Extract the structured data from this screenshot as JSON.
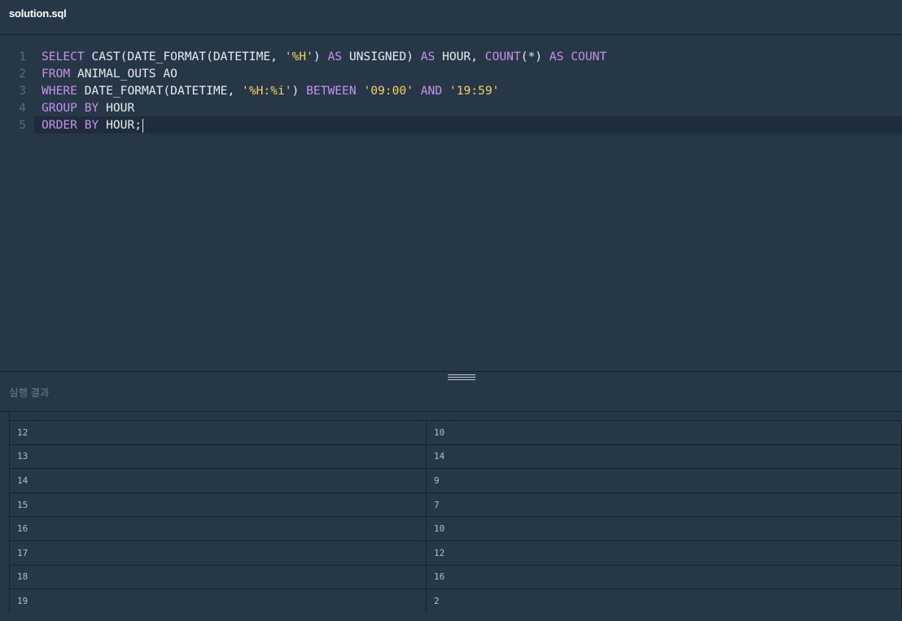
{
  "tab": {
    "title": "solution.sql"
  },
  "editor": {
    "line_numbers": [
      "1",
      "2",
      "3",
      "4",
      "5"
    ],
    "lines": [
      [
        {
          "t": "kw",
          "v": "SELECT"
        },
        {
          "t": "p",
          "v": " CAST(DATE_FORMAT(DATETIME, "
        },
        {
          "t": "str",
          "v": "'%H'"
        },
        {
          "t": "p",
          "v": ") "
        },
        {
          "t": "kw",
          "v": "AS"
        },
        {
          "t": "p",
          "v": " UNSIGNED) "
        },
        {
          "t": "kw",
          "v": "AS"
        },
        {
          "t": "p",
          "v": " HOUR, "
        },
        {
          "t": "kw",
          "v": "COUNT"
        },
        {
          "t": "p",
          "v": "(*) "
        },
        {
          "t": "kw",
          "v": "AS"
        },
        {
          "t": "p",
          "v": " "
        },
        {
          "t": "kw",
          "v": "COUNT"
        }
      ],
      [
        {
          "t": "kw",
          "v": "FROM"
        },
        {
          "t": "p",
          "v": " ANIMAL_OUTS AO"
        }
      ],
      [
        {
          "t": "kw",
          "v": "WHERE"
        },
        {
          "t": "p",
          "v": " DATE_FORMAT(DATETIME, "
        },
        {
          "t": "str",
          "v": "'%H:%i'"
        },
        {
          "t": "p",
          "v": ") "
        },
        {
          "t": "kw",
          "v": "BETWEEN"
        },
        {
          "t": "p",
          "v": " "
        },
        {
          "t": "str",
          "v": "'09:00'"
        },
        {
          "t": "p",
          "v": " "
        },
        {
          "t": "kw",
          "v": "AND"
        },
        {
          "t": "p",
          "v": " "
        },
        {
          "t": "str",
          "v": "'19:59'"
        }
      ],
      [
        {
          "t": "kw",
          "v": "GROUP BY"
        },
        {
          "t": "p",
          "v": " HOUR"
        }
      ],
      [
        {
          "t": "kw",
          "v": "ORDER BY"
        },
        {
          "t": "p",
          "v": " HOUR;"
        }
      ]
    ],
    "active_line": 5
  },
  "results": {
    "title": "실행 결과",
    "rows": [
      [
        "12",
        "10"
      ],
      [
        "13",
        "14"
      ],
      [
        "14",
        "9"
      ],
      [
        "15",
        "7"
      ],
      [
        "16",
        "10"
      ],
      [
        "17",
        "12"
      ],
      [
        "18",
        "16"
      ],
      [
        "19",
        "2"
      ]
    ]
  }
}
